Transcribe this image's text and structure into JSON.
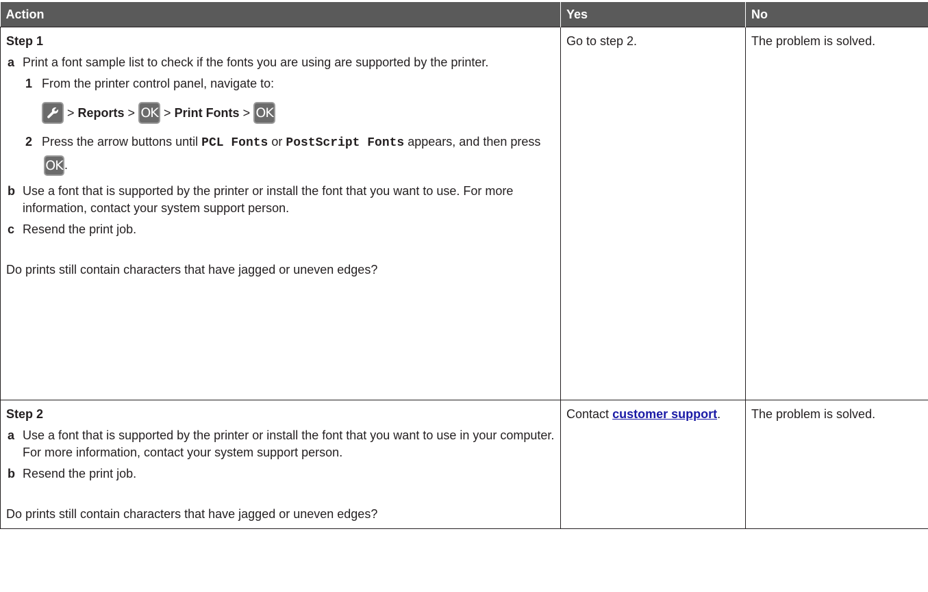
{
  "columns": {
    "action": "Action",
    "yes": "Yes",
    "no": "No"
  },
  "step1": {
    "title": "Step 1",
    "a_mark": "a",
    "a_text": "Print a font sample list to check if the fonts you are using are supported by the printer.",
    "sub1_mark": "1",
    "sub1_text": "From the printer control panel, navigate to:",
    "path": {
      "sep": ">",
      "reports": "Reports",
      "ok": "OK",
      "print_fonts": "Print Fonts"
    },
    "sub2_mark": "2",
    "sub2_text_a": "Press the arrow buttons until",
    "sub2_code1": "PCL Fonts",
    "sub2_or": "or",
    "sub2_code2": "PostScript Fonts",
    "sub2_text_b": "appears, and then press",
    "sub2_end": ".",
    "b_mark": "b",
    "b_text": "Use a font that is supported by the printer or install the font that you want to use. For more information, contact your system support person.",
    "c_mark": "c",
    "c_text": "Resend the print job.",
    "question": "Do prints still contain characters that have jagged or uneven edges?",
    "yes": "Go to step 2.",
    "no": "The problem is solved."
  },
  "step2": {
    "title": "Step 2",
    "a_mark": "a",
    "a_text": "Use a font that is supported by the printer or install the font that you want to use in your computer. For more information, contact your system support person.",
    "b_mark": "b",
    "b_text": "Resend the print job.",
    "question": "Do prints still contain characters that have jagged or uneven edges?",
    "yes_prefix": "Contact",
    "yes_link": "customer support",
    "yes_suffix": ".",
    "no": "The problem is solved."
  },
  "icons": {
    "settings": "wrench-icon",
    "ok": "ok-button-icon"
  },
  "colors": {
    "header_bg": "#5a5a5a",
    "link": "#1a1aa6",
    "button": "#6b6b6b"
  }
}
